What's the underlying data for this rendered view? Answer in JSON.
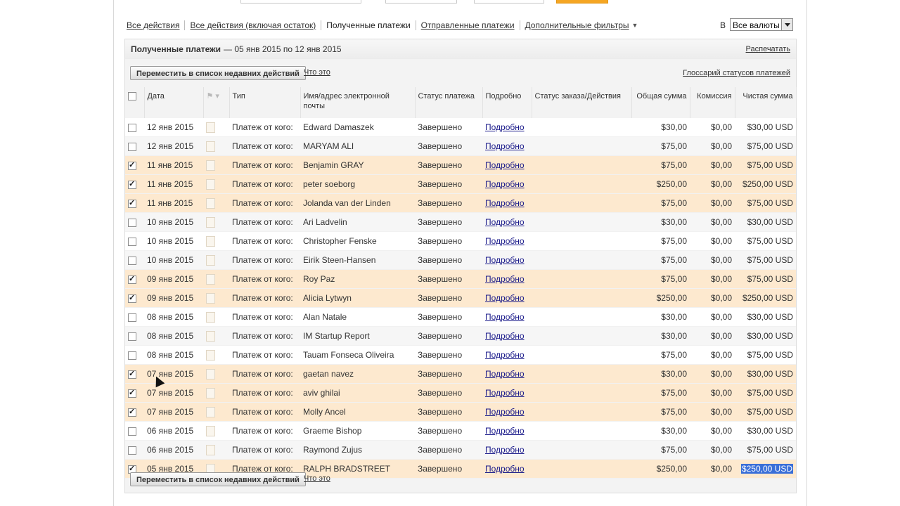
{
  "tabs": [
    {
      "label": "Все действия",
      "active": false
    },
    {
      "label": "Все действия (включая остаток)",
      "active": false
    },
    {
      "label": "Полученные платежи",
      "active": true
    },
    {
      "label": "Отправленные платежи",
      "active": false
    },
    {
      "label": "Дополнительные фильтры",
      "active": false
    }
  ],
  "currency": {
    "label": "В",
    "value": "Все валюты"
  },
  "panel": {
    "title": "Полученные платежи",
    "range": "— 05 янв 2015 по 12 янв 2015",
    "print_label": "Распечатать",
    "move_button": "Переместить в список недавних действий",
    "what_link": "Что это",
    "glossary_link": "Глоссарий статусов платежей"
  },
  "columns": {
    "date": "Дата",
    "type": "Тип",
    "name": "Имя/адрес электронной почты",
    "status": "Статус платежа",
    "details": "Подробно",
    "order": "Статус заказа/Действия",
    "gross": "Общая сумма",
    "fee": "Комиссия",
    "net": "Чистая сумма"
  },
  "rows": [
    {
      "checked": false,
      "date": "12 янв 2015",
      "type": "Платеж от кого:",
      "name": "Edward Damaszek",
      "status": "Завершено",
      "details": "Подробно",
      "gross": "$30,00",
      "fee": "$0,00",
      "net": "$30,00 USD"
    },
    {
      "checked": false,
      "date": "12 янв 2015",
      "type": "Платеж от кого:",
      "name": "MARYAM ALI",
      "status": "Завершено",
      "details": "Подробно",
      "gross": "$75,00",
      "fee": "$0,00",
      "net": "$75,00 USD"
    },
    {
      "checked": true,
      "date": "11 янв 2015",
      "type": "Платеж от кого:",
      "name": "Benjamin GRAY",
      "status": "Завершено",
      "details": "Подробно",
      "gross": "$75,00",
      "fee": "$0,00",
      "net": "$75,00 USD"
    },
    {
      "checked": true,
      "date": "11 янв 2015",
      "type": "Платеж от кого:",
      "name": "peter soeborg",
      "status": "Завершено",
      "details": "Подробно",
      "gross": "$250,00",
      "fee": "$0,00",
      "net": "$250,00 USD"
    },
    {
      "checked": true,
      "date": "11 янв 2015",
      "type": "Платеж от кого:",
      "name": "Jolanda van der Linden",
      "status": "Завершено",
      "details": "Подробно",
      "gross": "$75,00",
      "fee": "$0,00",
      "net": "$75,00 USD"
    },
    {
      "checked": false,
      "date": "10 янв 2015",
      "type": "Платеж от кого:",
      "name": "Ari Ladvelin",
      "status": "Завершено",
      "details": "Подробно",
      "gross": "$30,00",
      "fee": "$0,00",
      "net": "$30,00 USD"
    },
    {
      "checked": false,
      "date": "10 янв 2015",
      "type": "Платеж от кого:",
      "name": "Christopher Fenske",
      "status": "Завершено",
      "details": "Подробно",
      "gross": "$75,00",
      "fee": "$0,00",
      "net": "$75,00 USD"
    },
    {
      "checked": false,
      "date": "10 янв 2015",
      "type": "Платеж от кого:",
      "name": "Eirik Steen-Hansen",
      "status": "Завершено",
      "details": "Подробно",
      "gross": "$75,00",
      "fee": "$0,00",
      "net": "$75,00 USD"
    },
    {
      "checked": true,
      "date": "09 янв 2015",
      "type": "Платеж от кого:",
      "name": "Roy Paz",
      "status": "Завершено",
      "details": "Подробно",
      "gross": "$75,00",
      "fee": "$0,00",
      "net": "$75,00 USD"
    },
    {
      "checked": true,
      "date": "09 янв 2015",
      "type": "Платеж от кого:",
      "name": "Alicia Lytwyn",
      "status": "Завершено",
      "details": "Подробно",
      "gross": "$250,00",
      "fee": "$0,00",
      "net": "$250,00 USD"
    },
    {
      "checked": false,
      "date": "08 янв 2015",
      "type": "Платеж от кого:",
      "name": "Alan Natale",
      "status": "Завершено",
      "details": "Подробно",
      "gross": "$30,00",
      "fee": "$0,00",
      "net": "$30,00 USD"
    },
    {
      "checked": false,
      "date": "08 янв 2015",
      "type": "Платеж от кого:",
      "name": "IM Startup Report",
      "status": "Завершено",
      "details": "Подробно",
      "gross": "$30,00",
      "fee": "$0,00",
      "net": "$30,00 USD"
    },
    {
      "checked": false,
      "date": "08 янв 2015",
      "type": "Платеж от кого:",
      "name": "Tauam Fonseca Oliveira",
      "status": "Завершено",
      "details": "Подробно",
      "gross": "$75,00",
      "fee": "$0,00",
      "net": "$75,00 USD"
    },
    {
      "checked": true,
      "date": "07 янв 2015",
      "type": "Платеж от кого:",
      "name": "gaetan navez",
      "status": "Завершено",
      "details": "Подробно",
      "gross": "$30,00",
      "fee": "$0,00",
      "net": "$30,00 USD"
    },
    {
      "checked": true,
      "date": "07 янв 2015",
      "type": "Платеж от кого:",
      "name": "aviv ghilai",
      "status": "Завершено",
      "details": "Подробно",
      "gross": "$75,00",
      "fee": "$0,00",
      "net": "$75,00 USD"
    },
    {
      "checked": true,
      "date": "07 янв 2015",
      "type": "Платеж от кого:",
      "name": "Molly Ancel",
      "status": "Завершено",
      "details": "Подробно",
      "gross": "$75,00",
      "fee": "$0,00",
      "net": "$75,00 USD"
    },
    {
      "checked": false,
      "date": "06 янв 2015",
      "type": "Платеж от кого:",
      "name": "Graeme Bishop",
      "status": "Завершено",
      "details": "Подробно",
      "gross": "$30,00",
      "fee": "$0,00",
      "net": "$30,00 USD"
    },
    {
      "checked": false,
      "date": "06 янв 2015",
      "type": "Платеж от кого:",
      "name": "Raymond Zujus",
      "status": "Завершено",
      "details": "Подробно",
      "gross": "$75,00",
      "fee": "$0,00",
      "net": "$75,00 USD"
    },
    {
      "checked": true,
      "date": "05 янв 2015",
      "type": "Платеж от кого:",
      "name": "RALPH BRADSTREET",
      "status": "Завершено",
      "details": "Подробно",
      "gross": "$250,00",
      "fee": "$0,00",
      "net": "$250,00 USD",
      "net_selected": true
    }
  ],
  "colors": {
    "checked_row": "#fde9cf",
    "selection": "#3a6fd8",
    "accent_button": "#f5a623"
  }
}
